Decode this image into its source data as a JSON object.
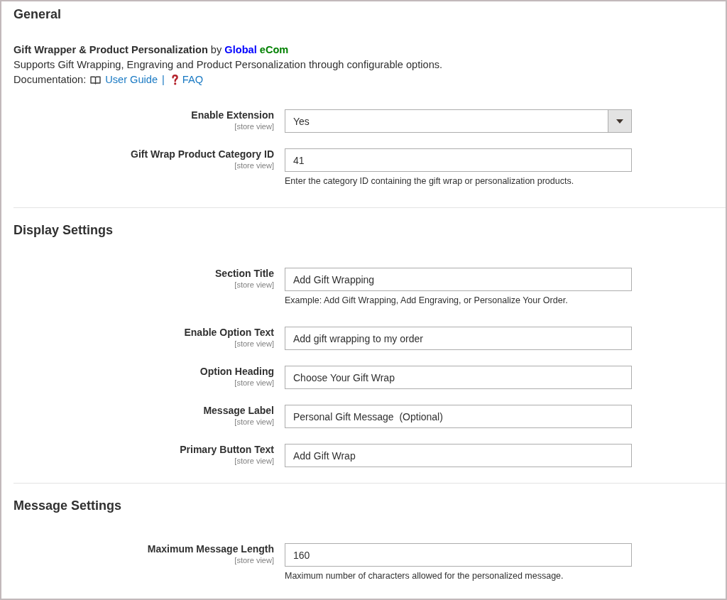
{
  "sections": [
    {
      "title": "General",
      "intro": {
        "credit": "**Gift Wrapper & Product Personalization** by",
        "vendor": [
          {
            "text": "Global",
            "color": "#0000ff"
          },
          {
            "text": "eCom",
            "color": "#008000"
          }
        ],
        "description": "Supports Gift Wrapping, Engraving and Product Personalization through configurable options.",
        "documentation": {
          "label": "Documentation:",
          "separator": "|",
          "links": [
            {
              "kind": "guide",
              "text": "User Guide"
            },
            {
              "kind": "faq",
              "text": "FAQ"
            }
          ]
        }
      },
      "fields": [
        {
          "kind": "select",
          "label": "Enable Extension",
          "scope": "[store view]",
          "value": "Yes"
        },
        {
          "kind": "text",
          "label": "Gift Wrap Product Category ID",
          "scope": "[store view]",
          "value": "41",
          "note": "Enter the category ID containing the gift wrap or personalization products."
        }
      ]
    },
    {
      "title": "Display Settings",
      "fields": [
        {
          "kind": "text",
          "label": "Section Title",
          "scope": "[store view]",
          "value": "Add Gift Wrapping",
          "note": "Example: Add Gift Wrapping, Add Engraving, or Personalize Your Order."
        },
        {
          "kind": "text",
          "label": "Enable Option Text",
          "scope": "[store view]",
          "value": "Add gift wrapping to my order"
        },
        {
          "kind": "text",
          "label": "Option Heading",
          "scope": "[store view]",
          "value": "Choose Your Gift Wrap"
        },
        {
          "kind": "text",
          "label": "Message Label",
          "scope": "[store view]",
          "value": "Personal Gift Message  (Optional)"
        },
        {
          "kind": "text",
          "label": "Primary Button Text",
          "scope": "[store view]",
          "value": "Add Gift Wrap"
        }
      ]
    },
    {
      "title": "Message Settings",
      "fields": [
        {
          "kind": "text",
          "label": "Maximum Message Length",
          "scope": "[store view]",
          "value": "160",
          "note": "Maximum number of characters allowed for the personalized message."
        }
      ]
    }
  ]
}
